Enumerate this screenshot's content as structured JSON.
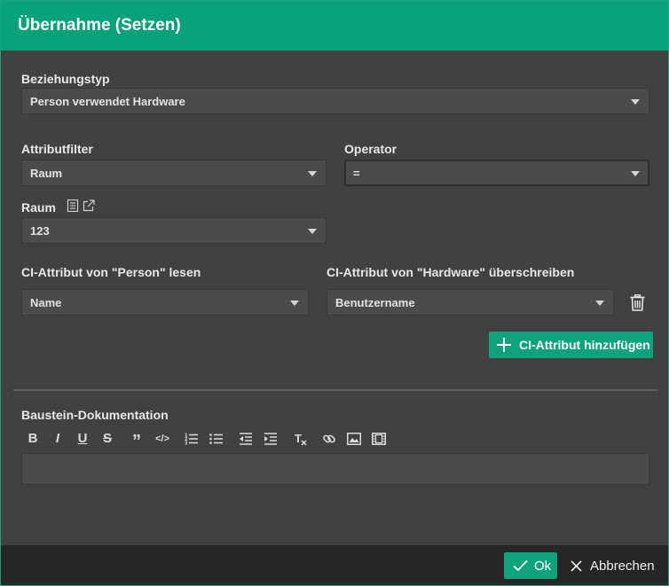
{
  "dialog": {
    "title": "Übernahme (Setzen)"
  },
  "relation": {
    "label": "Beziehungstyp",
    "value": "Person verwendet Hardware"
  },
  "attribute_filter": {
    "label": "Attributfilter",
    "value": "Raum"
  },
  "operator": {
    "label": "Operator",
    "value": "="
  },
  "room": {
    "label": "Raum",
    "value": "123",
    "icons": [
      "list-icon",
      "external-link-icon"
    ]
  },
  "mapping": {
    "read_label": "CI-Attribut von \"Person\" lesen",
    "write_label": "CI-Attribut von \"Hardware\" überschreiben",
    "rows": [
      {
        "read_value": "Name",
        "write_value": "Benutzername"
      }
    ],
    "add_label": "CI-Attribut hinzufügen"
  },
  "documentation": {
    "label": "Baustein-Dokumentation",
    "toolbar": [
      "bold-icon",
      "italic-icon",
      "underline-icon",
      "strikethrough-icon",
      "quote-icon",
      "code-icon",
      "ordered-list-icon",
      "bullet-list-icon",
      "outdent-icon",
      "indent-icon",
      "clear-format-icon",
      "link-icon",
      "image-icon",
      "video-icon"
    ],
    "content": ""
  },
  "footer": {
    "ok_label": "Ok",
    "cancel_label": "Abbrechen"
  },
  "colors": {
    "accent": "#09a27a",
    "background": "#414141",
    "field": "#4b4b4b",
    "footer": "#262626"
  }
}
